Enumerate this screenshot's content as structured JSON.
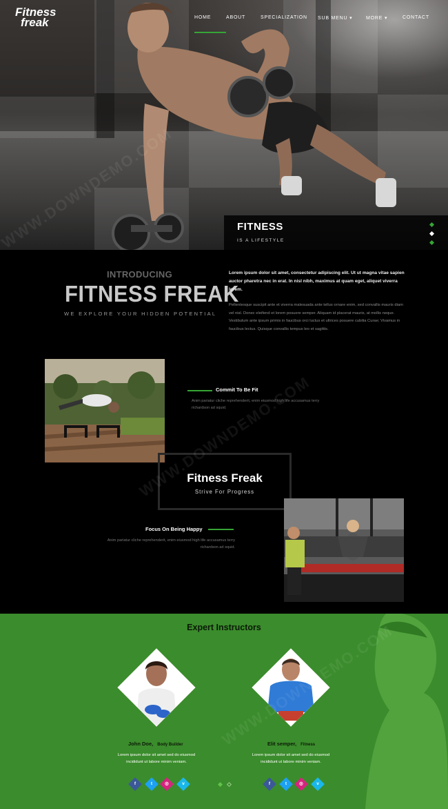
{
  "brand": {
    "line1": "Fitness",
    "line2": "freak"
  },
  "nav": [
    {
      "label": "HOME",
      "active": true
    },
    {
      "label": "ABOUT",
      "active": false
    },
    {
      "label": "SPECIALIZATION",
      "active": false
    },
    {
      "label": "SUB MENU ▾",
      "active": false
    },
    {
      "label": "MORE ▾",
      "active": false
    },
    {
      "label": "CONTACT",
      "active": false
    }
  ],
  "hero": {
    "title": "FITNESS",
    "subtitle": "IS A LIFESTYLE",
    "slides": 3,
    "active_slide": 2
  },
  "intro": {
    "kicker": "INTRODUCING",
    "title": "FITNESS FREAK",
    "subtitle": "WE EXPLORE YOUR HIDDEN POTENTIAL",
    "lead": "Lorem ipsum dolor sit amet, consectetur adipiscing elit. Ut ut magna vitae sapien auctor pharetra nec in erat. In nisl nibh, maximus at quam eget, aliquet viverra lorem.",
    "body": "Pellentesque suscipit ante et viverra malesuada ante tellus ornare enim, sed convallis mauris diam vel nisl. Donec eleifend et lorem posuere semper. Aliquam id placerat mauris, at mollis neque. Vestibulum ante ipsum primis in faucibus orci luctus et ultrices posuere cubilia Curae; Vivamus in faucibus lectus. Quisque convallis tempus leo et sagittis."
  },
  "features": {
    "commit_title": "Commit To Be Fit",
    "commit_text": "Anim pariatur cliche reprehenderit, enim eiusmod high life accusamus terry richardson ad squid.",
    "center_title": "Fitness Freak",
    "center_sub": "Strive For Progress",
    "happy_title": "Focus On Being Happy",
    "happy_text": "Anim pariatur cliche reprehenderit, enim eiusmod high life accusamus terry richardson ad squid."
  },
  "instructors": {
    "title": "Expert Instructors",
    "people": [
      {
        "name": "John Doe,",
        "role": "Body Builder",
        "bio": "Lorem ipsum dolor sit amet sed do eiusmod incididunt ut labore minim veniam."
      },
      {
        "name": "Elit semper,",
        "role": "Fitness",
        "bio": "Lorem ipsum dolor sit amet sed do eiusmod incididunt ut labore minim veniam."
      }
    ],
    "social": [
      {
        "icon": "facebook-icon",
        "glyph": "f",
        "color": "#3b5998"
      },
      {
        "icon": "twitter-icon",
        "glyph": "t",
        "color": "#1da1f2"
      },
      {
        "icon": "instagram-icon",
        "glyph": "◎",
        "color": "#d6247f"
      },
      {
        "icon": "vimeo-icon",
        "glyph": "v",
        "color": "#1ab7ea"
      }
    ]
  },
  "watermark": "WWW.DOWNDEMO.COM",
  "colors": {
    "accent": "#36a535",
    "green_bg": "#3b8c2c",
    "dark": "#000000"
  }
}
